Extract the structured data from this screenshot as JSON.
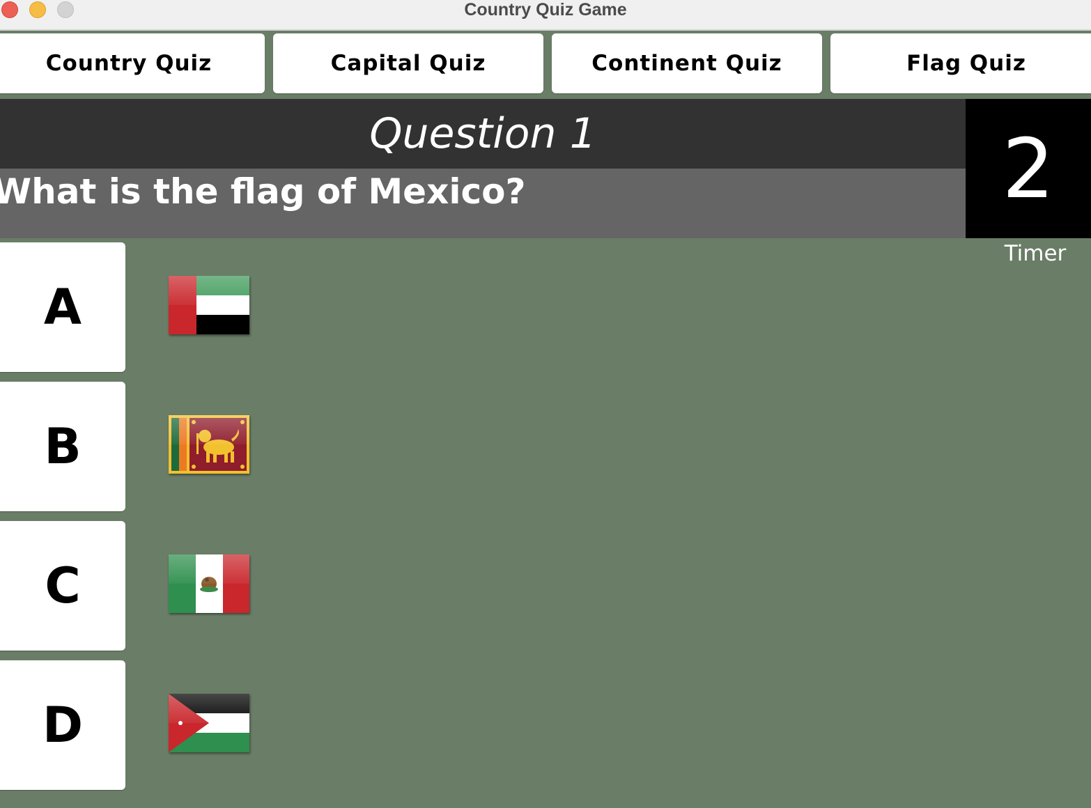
{
  "window": {
    "title": "Country Quiz Game"
  },
  "tabs": [
    {
      "label": "Country Quiz"
    },
    {
      "label": "Capital Quiz"
    },
    {
      "label": "Continent Quiz"
    },
    {
      "label": "Flag Quiz"
    }
  ],
  "question": {
    "number_label": "Question 1",
    "text": "What is the flag of Mexico?"
  },
  "timer": {
    "value": "2",
    "label": "Timer"
  },
  "answers": [
    {
      "letter": "A",
      "flag_icon": "uae-flag-icon"
    },
    {
      "letter": "B",
      "flag_icon": "sri-lanka-flag-icon"
    },
    {
      "letter": "C",
      "flag_icon": "mexico-flag-icon"
    },
    {
      "letter": "D",
      "flag_icon": "jordan-flag-icon"
    }
  ],
  "colors": {
    "background": "#6a7d67",
    "question_header": "#323232",
    "question_text_bar": "#656565",
    "timer_box": "#000000"
  }
}
